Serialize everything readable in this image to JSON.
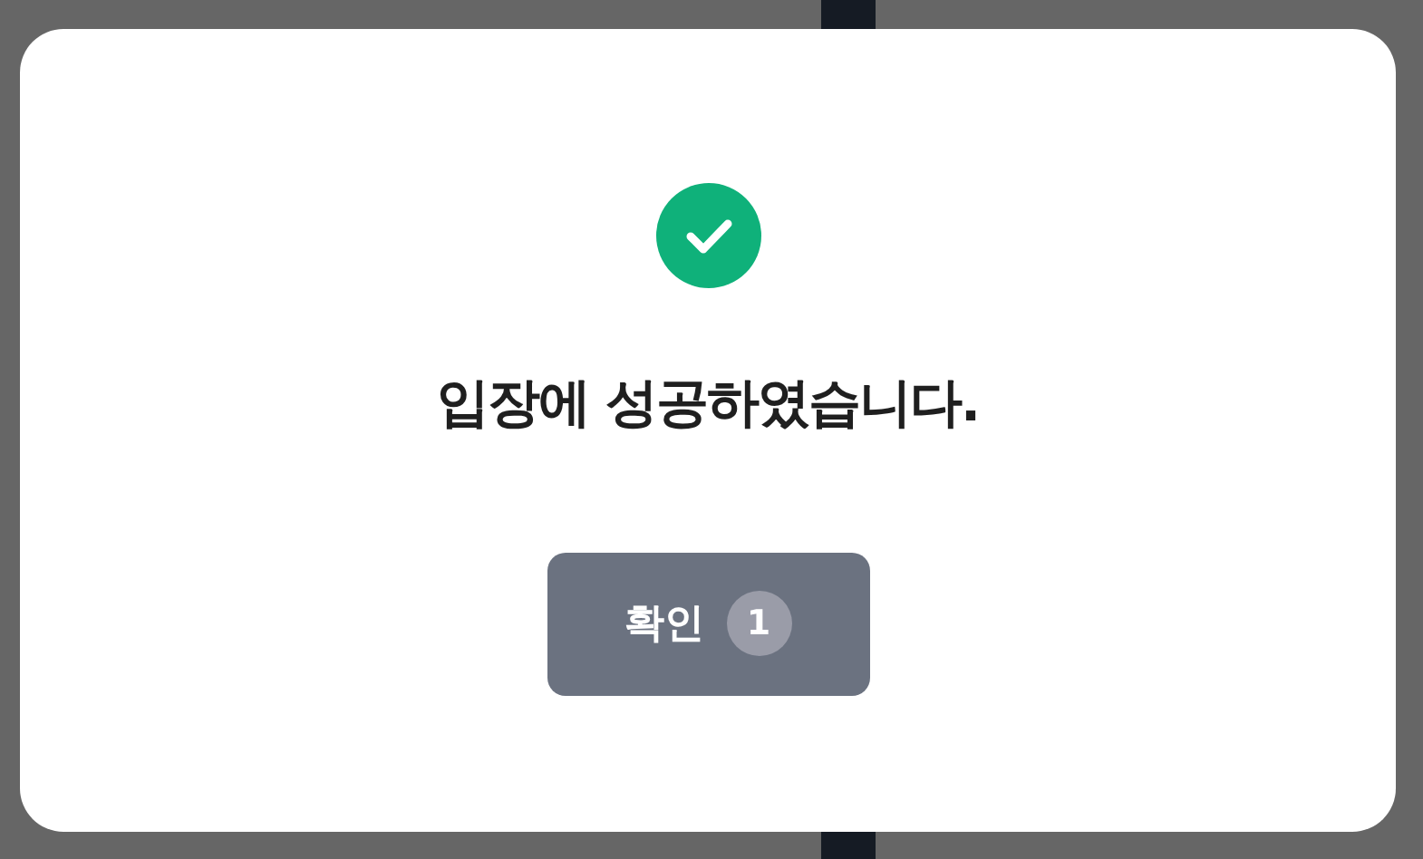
{
  "dialog": {
    "succeeded": true,
    "message": "입장에 성공하였습니다.",
    "confirm_button": {
      "label": "확인",
      "count": "1"
    }
  }
}
